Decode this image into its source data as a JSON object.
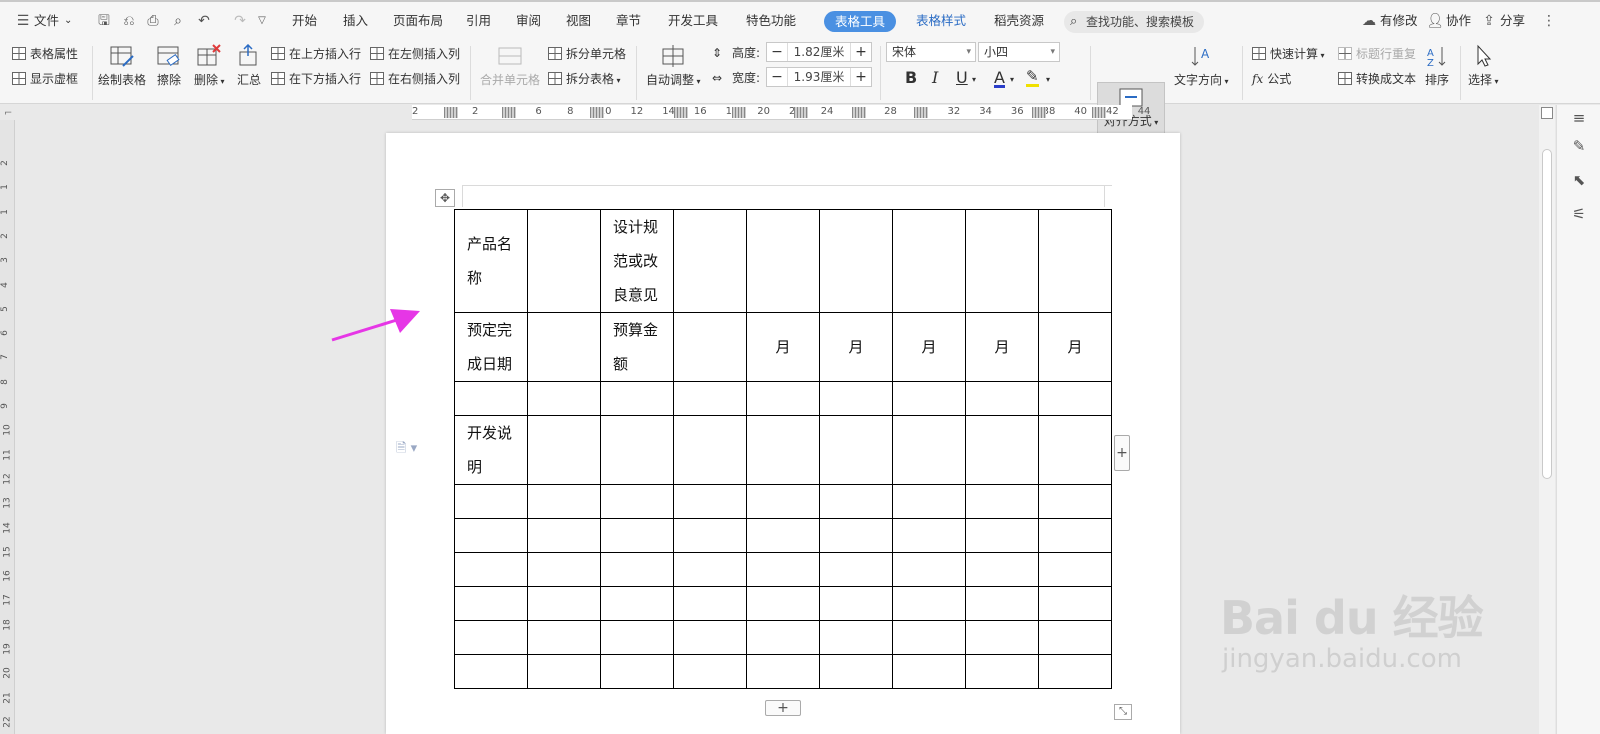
{
  "menubar": {
    "file_label": "文件",
    "tabs": [
      "开始",
      "插入",
      "页面布局",
      "引用",
      "审阅",
      "视图",
      "章节",
      "开发工具",
      "特色功能"
    ],
    "active_tab": "表格工具",
    "style_tab": "表格样式",
    "resource_tab": "稻壳资源",
    "search_placeholder": "查找功能、搜索模板",
    "modified_label": "有修改",
    "collab_label": "协作",
    "share_label": "分享"
  },
  "ribbon": {
    "table_props": "表格属性",
    "show_gridlines": "显示虚框",
    "draw_table": "绘制表格",
    "erase": "擦除",
    "delete": "删除",
    "summary": "汇总",
    "insert_above": "在上方插入行",
    "insert_below": "在下方插入行",
    "insert_left": "在左侧插入列",
    "insert_right": "在右侧插入列",
    "merge_cells": "合并单元格",
    "split_cells": "拆分单元格",
    "split_table": "拆分表格",
    "auto_fit": "自动调整",
    "height_label": "高度:",
    "height_value": "1.82厘米",
    "width_label": "宽度:",
    "width_value": "1.93厘米",
    "font_name": "宋体",
    "font_size": "小四",
    "bold": "B",
    "italic": "I",
    "underline": "U",
    "font_color": "A",
    "align": "对齐方式",
    "text_direction": "文字方向",
    "quick_calc": "快速计算",
    "repeat_header": "标题行重复",
    "formula": "公式",
    "to_text": "转换成文本",
    "sort": "排序",
    "select": "选择"
  },
  "ruler": {
    "h_ticks": [
      "2",
      "2",
      "4",
      "6",
      "8",
      "10",
      "12",
      "14",
      "16",
      "18",
      "20",
      "22",
      "24",
      "26",
      "28",
      "30",
      "32",
      "34",
      "36",
      "38",
      "40",
      "42",
      "44"
    ],
    "v_ticks": [
      "2",
      "1",
      "1",
      "2",
      "3",
      "4",
      "5",
      "6",
      "7",
      "8",
      "9",
      "10",
      "11",
      "12",
      "13",
      "14",
      "15",
      "16",
      "17",
      "18",
      "19",
      "20",
      "21",
      "22"
    ]
  },
  "table": {
    "rows": [
      [
        "产品名称",
        "",
        "设计规范或改良意见",
        "",
        "",
        "",
        "",
        "",
        ""
      ],
      [
        "预定完成日期",
        "",
        "预算金额",
        "",
        "月",
        "月",
        "月",
        "月",
        "月"
      ],
      [
        "",
        "",
        "",
        "",
        "",
        "",
        "",
        "",
        ""
      ],
      [
        "开发说明",
        "",
        "",
        "",
        "",
        "",
        "",
        "",
        ""
      ],
      [
        "",
        "",
        "",
        "",
        "",
        "",
        "",
        "",
        ""
      ],
      [
        "",
        "",
        "",
        "",
        "",
        "",
        "",
        "",
        ""
      ],
      [
        "",
        "",
        "",
        "",
        "",
        "",
        "",
        "",
        ""
      ],
      [
        "",
        "",
        "",
        "",
        "",
        "",
        "",
        "",
        ""
      ],
      [
        "",
        "",
        "",
        "",
        "",
        "",
        "",
        "",
        ""
      ],
      [
        "",
        "",
        "",
        "",
        "",
        "",
        "",
        "",
        ""
      ]
    ],
    "add_row": "+",
    "add_col": "+"
  },
  "watermark": {
    "brand": "Bai du 经验",
    "url": "jingyan.baidu.com"
  },
  "colors": {
    "accent": "#4a90e2",
    "arrow": "#e636e6"
  }
}
